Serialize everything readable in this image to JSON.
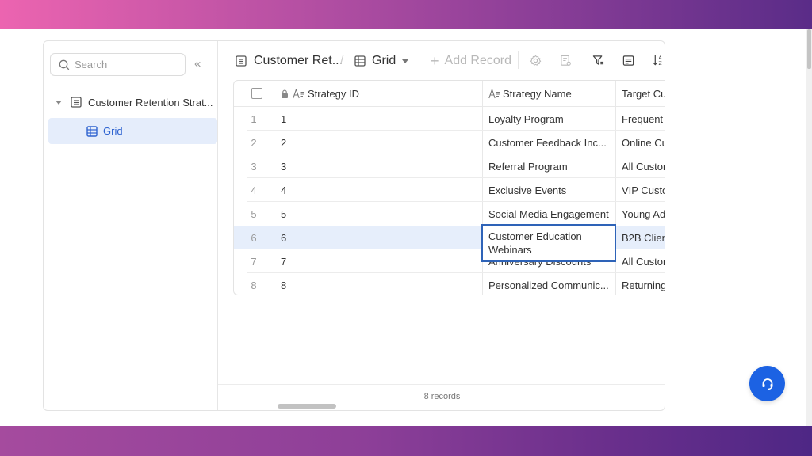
{
  "sidebar": {
    "search_placeholder": "Search",
    "collapse_label": "«",
    "table_name": "Customer Retention Strat...",
    "view_name": "Grid"
  },
  "toolbar": {
    "table_title": "Customer Ret...",
    "separator": "/",
    "view_label": "Grid",
    "add_record_label": "Add Record",
    "icons": [
      "settings-icon",
      "form-settings-icon",
      "filter-icon",
      "list-icon",
      "sort-icon"
    ]
  },
  "grid": {
    "columns": [
      {
        "label": "Strategy ID",
        "locked": true
      },
      {
        "label": "Strategy Name"
      },
      {
        "label": "Target Cus"
      }
    ],
    "rows": [
      {
        "index": "1",
        "id": "1",
        "name": "Loyalty Program",
        "target": "Frequent"
      },
      {
        "index": "2",
        "id": "2",
        "name": "Customer Feedback Inc...",
        "target": "Online Cu"
      },
      {
        "index": "3",
        "id": "3",
        "name": "Referral Program",
        "target": "All Custor"
      },
      {
        "index": "4",
        "id": "4",
        "name": "Exclusive Events",
        "target": "VIP Custo"
      },
      {
        "index": "5",
        "id": "5",
        "name": "Social Media Engagement",
        "target": "Young Ad"
      },
      {
        "index": "6",
        "id": "6",
        "name": "Customer Education Webinars",
        "target": "B2B Clien"
      },
      {
        "index": "7",
        "id": "7",
        "name": "Anniversary Discounts",
        "target": "All Custor"
      },
      {
        "index": "8",
        "id": "8",
        "name": "Personalized Communic...",
        "target": "Returning"
      }
    ],
    "selected_row": 6,
    "editing_cell_text": "Customer Education Webinars"
  },
  "footer": {
    "record_count": "8 records"
  },
  "colors": {
    "accent": "#2e63d0",
    "fab": "#1c62e3",
    "selected_row": "#e6eefb"
  }
}
